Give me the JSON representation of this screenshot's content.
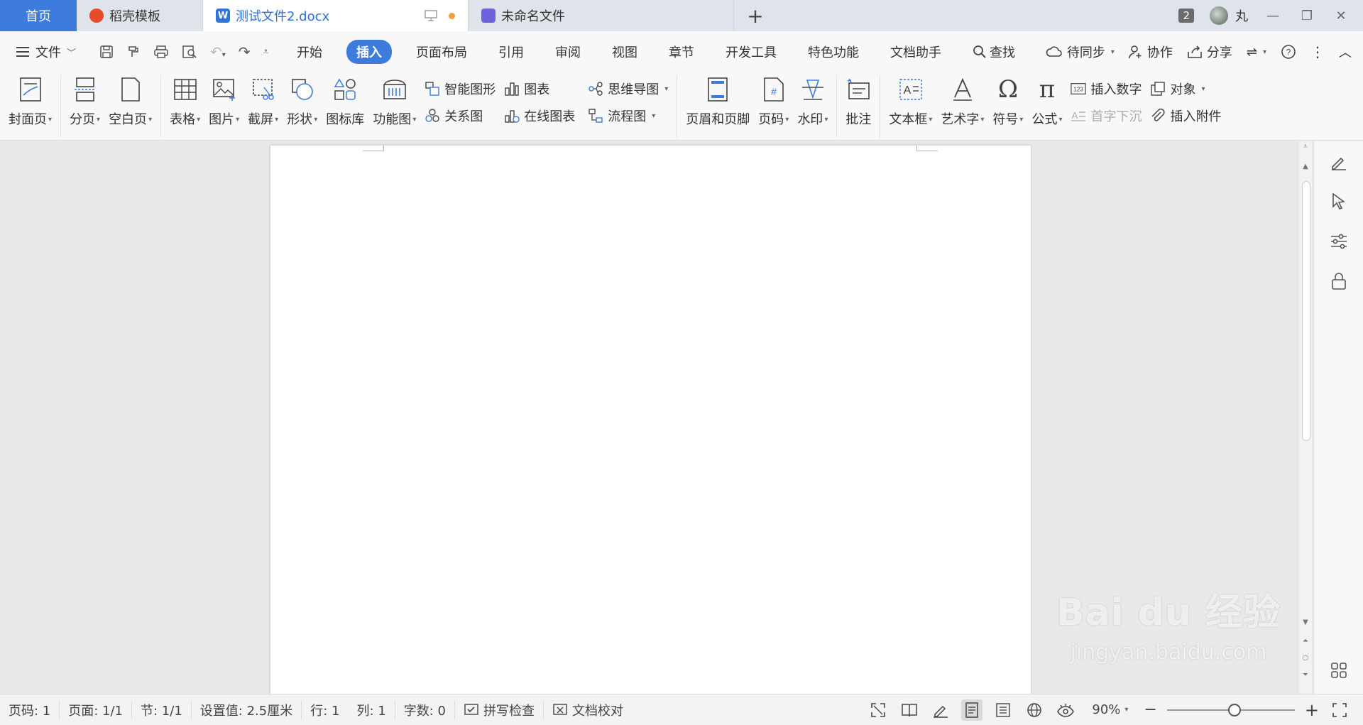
{
  "tabs": {
    "home": "首页",
    "daoke": "稻壳模板",
    "doc": "测试文件2.docx",
    "unnamed": "未命名文件",
    "badge": "2",
    "user": "丸"
  },
  "menu": {
    "file": "文件",
    "items": [
      "开始",
      "插入",
      "页面布局",
      "引用",
      "审阅",
      "视图",
      "章节",
      "开发工具",
      "特色功能",
      "文档助手"
    ],
    "search": "查找",
    "sync": "待同步",
    "collab": "协作",
    "share": "分享"
  },
  "ribbon": {
    "cover": "封面页",
    "pagebreak": "分页",
    "blank": "空白页",
    "table": "表格",
    "picture": "图片",
    "screenshot": "截屏",
    "shape": "形状",
    "iconlib": "图标库",
    "funcchart": "功能图",
    "smartart": "智能图形",
    "chart": "图表",
    "mindmap": "思维导图",
    "relation": "关系图",
    "onlinechart": "在线图表",
    "flowchart": "流程图",
    "header": "页眉和页脚",
    "pagenum": "页码",
    "watermark": "水印",
    "comment": "批注",
    "textbox": "文本框",
    "wordart": "艺术字",
    "symbol": "符号",
    "formula": "公式",
    "insertnum": "插入数字",
    "dropcap": "首字下沉",
    "object": "对象",
    "attachment": "插入附件"
  },
  "status": {
    "pagenum": "页码: 1",
    "pages": "页面: 1/1",
    "section": "节: 1/1",
    "setting": "设置值: 2.5厘米",
    "row": "行: 1",
    "col": "列: 1",
    "words": "字数: 0",
    "spell": "拼写检查",
    "proof": "文档校对",
    "zoom": "90%"
  },
  "watermark": {
    "brand": "Bai du 经验",
    "url": "jingyan.baidu.com"
  },
  "colors": {
    "accent": "#3d7cdd",
    "tabbar": "#dfe3ea"
  }
}
